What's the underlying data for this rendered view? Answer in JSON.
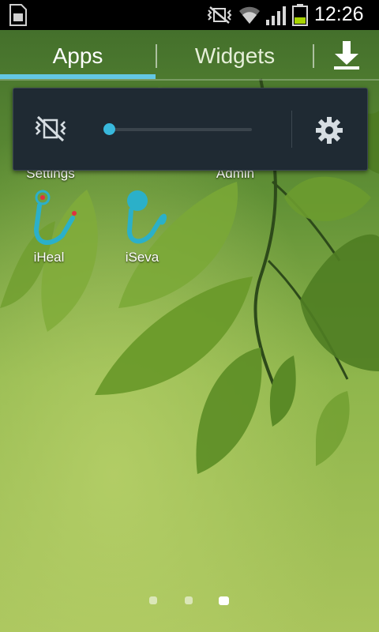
{
  "status_bar": {
    "time": "12:26",
    "icons": [
      "sim-card-icon",
      "mute-icon",
      "wifi-icon",
      "signal-icon",
      "battery-icon"
    ],
    "battery_level": 0.35
  },
  "tabs": {
    "items": [
      {
        "label": "Apps"
      },
      {
        "label": "Widgets"
      }
    ],
    "active_index": 0,
    "download_icon": "download-icon",
    "accent_color": "#63c7e4"
  },
  "apps": [
    {
      "label": "Settings"
    },
    {
      "label": "Admin"
    },
    {
      "label": "iHeal",
      "icon": "iheal-icon"
    },
    {
      "label": "iSeva",
      "icon": "iseva-icon"
    }
  ],
  "volume_panel": {
    "mute_icon": "vibrate-mute-icon",
    "volume_level": 0.0,
    "settings_icon": "gear-icon"
  },
  "page_indicator": {
    "count": 3,
    "active_index": 2
  }
}
